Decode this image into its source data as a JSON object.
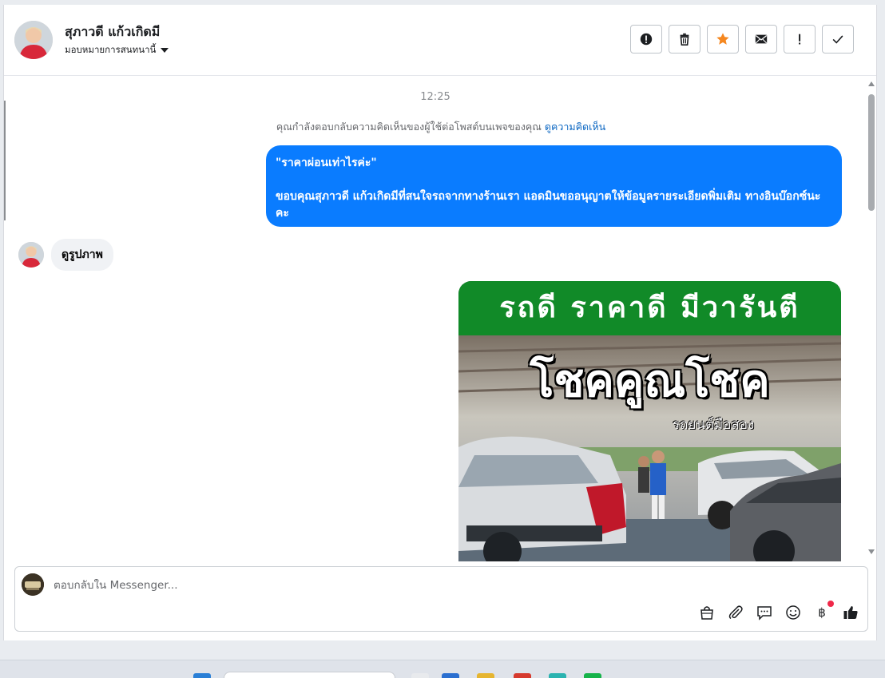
{
  "header": {
    "contact_name": "สุภาวดี แก้วเกิดมี",
    "assign_label": "มอบหมายการสนทนานี้",
    "actions": [
      {
        "icon": "spam-icon",
        "name": "mark-spam-button"
      },
      {
        "icon": "trash-icon",
        "name": "delete-button"
      },
      {
        "icon": "star-icon",
        "name": "star-button"
      },
      {
        "icon": "envelope-icon",
        "name": "mark-unread-button"
      },
      {
        "icon": "exclamation-icon",
        "name": "flag-button"
      },
      {
        "icon": "check-icon",
        "name": "mark-done-button"
      }
    ]
  },
  "chat": {
    "timestamp": "12:25",
    "notice_text": "คุณกำลังตอบกลับความคิดเห็นของผู้ใช้ต่อโพสต์บนเพจของคุณ",
    "notice_link": "ดูความคิดเห็น",
    "outgoing_message": "\"ราคาผ่อนเท่าไรค่ะ\"\n\nขอบคุณสุภาวดี แก้วเกิดมีที่สนใจรถจากทางร้านเรา แอดมินขออนุญาตให้ข้อมูลรายระเอียดพิ่มเติม ทางอินบ๊อกซ์นะคะ",
    "incoming_message": "ดูรูปภาพ",
    "image_banner": "รถดี ราคาดี มีวารันตี",
    "image_title": "โชคคูณโชค",
    "image_subtitle": "รถยนต์มือสอง"
  },
  "composer": {
    "placeholder": "ตอบกลับใน Messenger...",
    "currency_symbol": "฿"
  },
  "colors": {
    "outgoing_bubble": "#0a7cff",
    "incoming_bubble": "#f0f2f5",
    "banner_green": "#118a28",
    "star_orange": "#f5871f",
    "link_blue": "#0a66c2"
  }
}
